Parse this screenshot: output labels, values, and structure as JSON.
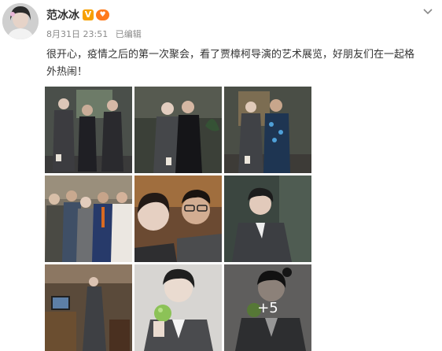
{
  "post": {
    "author": {
      "name": "范冰冰",
      "verified_badge": "V",
      "avatar_icon": "avatar-portrait"
    },
    "meta": {
      "date": "8月31日",
      "time": "23:51",
      "edited_label": "已编辑"
    },
    "text": "很开心，疫情之后的第一次聚会，看了贾樟柯导演的艺术展览，好朋友们在一起格外热闹！",
    "more_photos_label": "+5",
    "photo_count_shown": 9
  },
  "colors": {
    "name": "#333333",
    "meta": "#8a8a8a",
    "badge_v": "#f7a000",
    "badge_heart": "#ff7a1b"
  }
}
